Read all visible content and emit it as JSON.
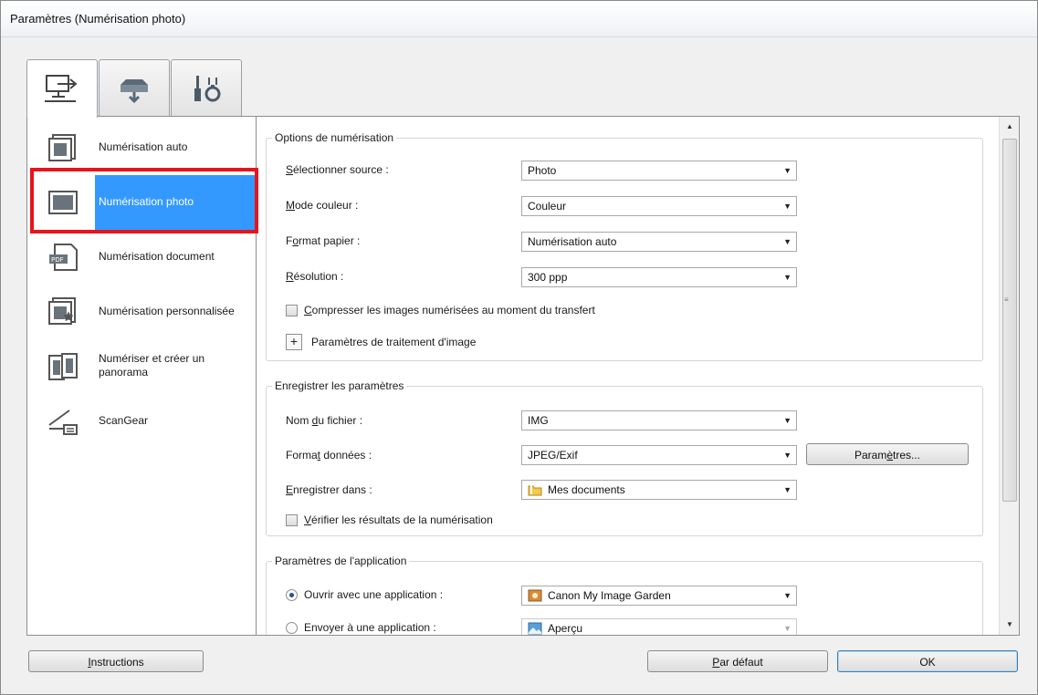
{
  "window": {
    "title": "Paramètres (Numérisation photo)"
  },
  "tabs": [
    {
      "icon": "scan-from-computer-icon"
    },
    {
      "icon": "scan-from-operation-panel-icon"
    },
    {
      "icon": "general-settings-icon"
    }
  ],
  "left_list": [
    {
      "label": "Numérisation auto",
      "icon": "auto-scan-icon"
    },
    {
      "label": "Numérisation photo",
      "icon": "photo-scan-icon",
      "selected": true
    },
    {
      "label": "Numérisation document",
      "icon": "document-scan-icon"
    },
    {
      "label": "Numérisation personnalisée",
      "icon": "custom-scan-icon"
    },
    {
      "label": "Numériser et créer un panorama",
      "icon": "panorama-icon"
    },
    {
      "label": "ScanGear",
      "icon": "scangear-icon"
    }
  ],
  "scan_options": {
    "legend": "Options de numérisation",
    "source": {
      "label_pre": "",
      "label_key": "S",
      "label_post": "électionner source :",
      "value": "Photo"
    },
    "color_mode": {
      "label_pre": "",
      "label_key": "M",
      "label_post": "ode couleur :",
      "value": "Couleur"
    },
    "paper_size": {
      "label_pre": "F",
      "label_key": "o",
      "label_post": "rmat papier :",
      "value": "Numérisation auto"
    },
    "resolution": {
      "label_pre": "",
      "label_key": "R",
      "label_post": "ésolution :",
      "value": "300 ppp"
    },
    "compress": {
      "label_pre": "",
      "label_key": "C",
      "label_post": "ompresser les images numérisées au moment du transfert",
      "checked": false
    },
    "image_processing": {
      "label": "Paramètres de traitement d'image"
    }
  },
  "save_settings": {
    "legend": "Enregistrer les paramètres",
    "file_name": {
      "label_pre": "Nom ",
      "label_key": "d",
      "label_post": "u fichier :",
      "value": "IMG"
    },
    "data_format": {
      "label_pre": "Forma",
      "label_key": "t",
      "label_post": " données :",
      "value": "JPEG/Exif"
    },
    "settings_button": {
      "label_pre": "Param",
      "label_key": "è",
      "label_post": "tres..."
    },
    "save_in": {
      "label_pre": "",
      "label_key": "E",
      "label_post": "nregistrer dans :",
      "value": "Mes documents"
    },
    "verify": {
      "label_pre": "",
      "label_key": "V",
      "label_post": "érifier les résultats de la numérisation",
      "checked": false
    }
  },
  "app_settings": {
    "legend": "Paramètres de l'application",
    "open_with": {
      "label": "Ouvrir avec une application :",
      "value": "Canon My Image Garden",
      "selected": true
    },
    "send_to": {
      "label": "Envoyer à une application :",
      "value": "Aperçu",
      "selected": false
    }
  },
  "footer": {
    "instructions": {
      "label_pre": "",
      "label_key": "I",
      "label_post": "nstructions"
    },
    "defaults": {
      "label_pre": "",
      "label_key": "P",
      "label_post": "ar défaut"
    },
    "ok": "OK"
  },
  "colors": {
    "selection": "#3399ff",
    "highlight_box": "#e8141c"
  }
}
